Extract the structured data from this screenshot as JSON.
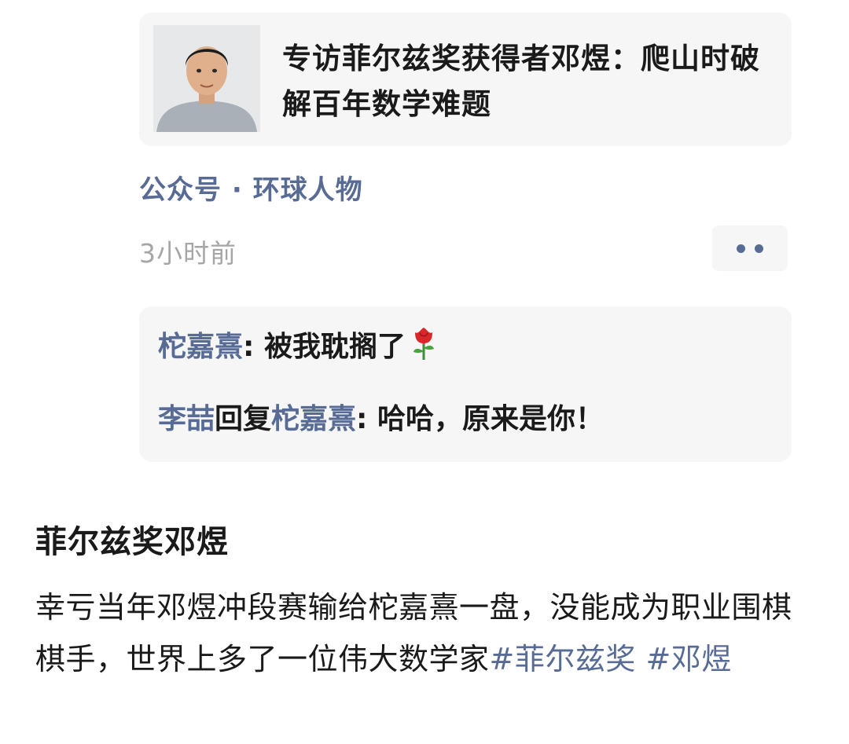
{
  "article": {
    "title": "专访菲尔兹奖获得者邓煜：爬山时破解百年数学难题",
    "thumbnail": "person-portrait"
  },
  "source": "公众号 · 环球人物",
  "timestamp": "3小时前",
  "comments": [
    {
      "author": "柁嘉熹",
      "separator": ": ",
      "text": "被我耽搁了",
      "emoji": "rose-icon"
    },
    {
      "author": "李喆",
      "reply_word": "回复",
      "reply_to": "柁嘉熹",
      "separator": ": ",
      "text": "哈哈，原来是你！"
    }
  ],
  "post": {
    "title": "菲尔兹奖邓煜",
    "body": "幸亏当年邓煜冲段赛输给柁嘉熹一盘，没能成为职业围棋棋手，世界上多了一位伟大数学家",
    "hashtag1": "#菲尔兹奖",
    "hashtag2": "#邓煜"
  },
  "colors": {
    "link": "#576b95",
    "card_bg": "#f6f6f7",
    "muted": "#a6a6a6",
    "text": "#1a1a1a"
  }
}
